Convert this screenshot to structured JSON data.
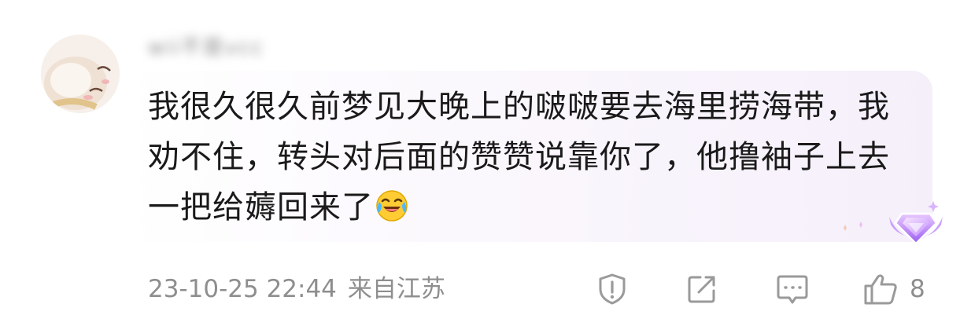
{
  "comment": {
    "username": "wii不是vcc",
    "text": "我很久很久前梦见大晚上的啵啵要去海里捞海带，我劝不住，转头对后面的赞赞说靠你了，他撸袖子上去一把给薅回来了",
    "emoji": "laughing-crying-emoji",
    "timestamp": "23-10-25 22:44",
    "location": "来自江苏",
    "like_count": "8"
  },
  "icons": {
    "report": "report-shield-icon",
    "share": "share-icon",
    "reply": "reply-comment-icon",
    "like": "thumbs-up-icon",
    "badge": "purple-diamond-badge-icon"
  },
  "colors": {
    "text": "#1a1a1a",
    "meta": "#8e8e8e",
    "bubble_accent": "#f5effa",
    "badge": "#b07cf0"
  }
}
